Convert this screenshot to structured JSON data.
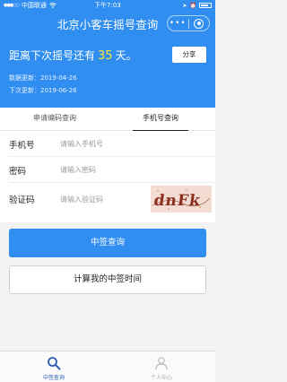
{
  "status_bar": {
    "carrier": "中国联通",
    "time": "下午7:03",
    "battery_percent": 60
  },
  "nav": {
    "title": "北京小客车摇号查询",
    "more_label": "•••"
  },
  "hero": {
    "countdown_prefix": "距离下次摇号还有",
    "countdown_days": "35",
    "countdown_suffix": "天。",
    "share_label": "分享",
    "data_update_label": "数据更新：",
    "data_update_date": "2019-04-26",
    "next_update_label": "下次更新：",
    "next_update_date": "2019-06-26"
  },
  "tabs": [
    {
      "label": "申请编码查询",
      "active": false
    },
    {
      "label": "手机号查询",
      "active": true
    }
  ],
  "form": {
    "phone": {
      "label": "手机号",
      "placeholder": "请输入手机号"
    },
    "password": {
      "label": "密码",
      "placeholder": "请输入密码"
    },
    "captcha": {
      "label": "验证码",
      "placeholder": "请输入验证码",
      "image_text": "dnFk"
    }
  },
  "buttons": {
    "query": "中签查询",
    "calculate": "计算我的中签时间"
  },
  "tabbar": [
    {
      "label": "中签查询",
      "icon": "search-icon",
      "active": true
    },
    {
      "label": "个人中心",
      "icon": "user-icon",
      "active": false
    }
  ],
  "colors": {
    "primary": "#2f8ef0",
    "highlight": "#ffe033",
    "tab_active": "#2f5fb4"
  }
}
